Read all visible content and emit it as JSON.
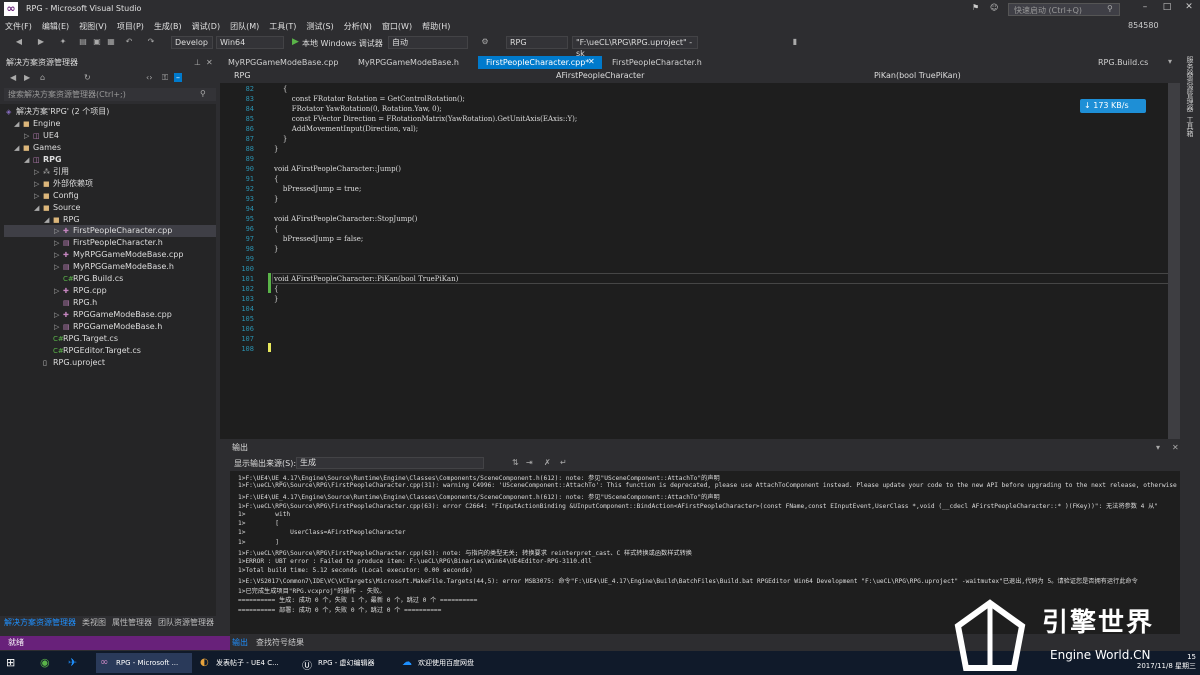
{
  "app": {
    "title": "RPG - Microsoft Visual Studio",
    "quick_launch": "快速启动 (Ctrl+Q)",
    "user_id": "854580"
  },
  "menu": [
    "文件(F)",
    "编辑(E)",
    "视图(V)",
    "项目(P)",
    "生成(B)",
    "调试(D)",
    "团队(M)",
    "工具(T)",
    "测试(S)",
    "分析(N)",
    "窗口(W)",
    "帮助(H)"
  ],
  "toolbar": {
    "config": "Develop",
    "platform": "Win64",
    "debugger": "本地 Windows 调试器",
    "debugger_mode": "自动",
    "project": "RPG",
    "uproject": "\"F:\\ueCL\\RPG\\RPG.uproject\" -sk"
  },
  "solution_explorer": {
    "title": "解决方案资源管理器",
    "search_placeholder": "搜索解决方案资源管理器(Ctrl+;)",
    "items": [
      {
        "label": "解决方案'RPG' (2 个项目)",
        "icon": "solution-icon"
      },
      {
        "label": "Engine",
        "icon": "folder-icon"
      },
      {
        "label": "UE4",
        "icon": "project-icon"
      },
      {
        "label": "Games",
        "icon": "folder-icon"
      },
      {
        "label": "RPG",
        "icon": "project-icon"
      },
      {
        "label": "引用",
        "icon": "reference-icon"
      },
      {
        "label": "外部依赖项",
        "icon": "dependency-icon"
      },
      {
        "label": "Config",
        "icon": "folder-icon"
      },
      {
        "label": "Source",
        "icon": "folder-icon"
      },
      {
        "label": "RPG",
        "icon": "folder-icon"
      },
      {
        "label": "FirstPeopleCharacter.cpp",
        "icon": "cpp-file-icon"
      },
      {
        "label": "FirstPeopleCharacter.h",
        "icon": "header-file-icon"
      },
      {
        "label": "MyRPGGameModeBase.cpp",
        "icon": "cpp-file-icon"
      },
      {
        "label": "MyRPGGameModeBase.h",
        "icon": "header-file-icon"
      },
      {
        "label": "RPG.Build.cs",
        "icon": "csharp-file-icon"
      },
      {
        "label": "RPG.cpp",
        "icon": "cpp-file-icon"
      },
      {
        "label": "RPG.h",
        "icon": "header-file-icon"
      },
      {
        "label": "RPGGameModeBase.cpp",
        "icon": "cpp-file-icon"
      },
      {
        "label": "RPGGameModeBase.h",
        "icon": "header-file-icon"
      },
      {
        "label": "RPG.Target.cs",
        "icon": "csharp-file-icon"
      },
      {
        "label": "RPGEditor.Target.cs",
        "icon": "csharp-file-icon"
      },
      {
        "label": "RPG.uproject",
        "icon": "file-icon"
      }
    ],
    "tabs": [
      "解决方案资源管理器",
      "类视图",
      "属性管理器",
      "团队资源管理器"
    ]
  },
  "editor": {
    "tabs": [
      "MyRPGGameModeBase.cpp",
      "MyRPGGameModeBase.h",
      "FirstPeopleCharacter.cpp*",
      "FirstPeopleCharacter.h",
      "RPG.Build.cs"
    ],
    "active_tab": "FirstPeopleCharacter.cpp*",
    "nav_project": "RPG",
    "nav_class": "AFirstPeopleCharacter",
    "nav_member": "PiKan(bool TruePiKan)",
    "net_speed": "↓ 173 KB/s",
    "lines": [
      {
        "n": "82",
        "text": "    {"
      },
      {
        "n": "83",
        "text": "        const FRotator Rotation = GetControlRotation();"
      },
      {
        "n": "84",
        "text": "        FRotator YawRotation(0, Rotation.Yaw, 0);"
      },
      {
        "n": "85",
        "text": "        const FVector Direction = FRotationMatrix(YawRotation).GetUnitAxis(EAxis::Y);"
      },
      {
        "n": "86",
        "text": "        AddMovementInput(Direction, val);"
      },
      {
        "n": "87",
        "text": "    }"
      },
      {
        "n": "88",
        "text": "}"
      },
      {
        "n": "89",
        "text": ""
      },
      {
        "n": "90",
        "text": "void AFirstPeopleCharacter::Jump()"
      },
      {
        "n": "91",
        "text": "{"
      },
      {
        "n": "92",
        "text": "    bPressedJump = true;"
      },
      {
        "n": "93",
        "text": "}"
      },
      {
        "n": "94",
        "text": ""
      },
      {
        "n": "95",
        "text": "void AFirstPeopleCharacter::StopJump()"
      },
      {
        "n": "96",
        "text": "{"
      },
      {
        "n": "97",
        "text": "    bPressedJump = false;"
      },
      {
        "n": "98",
        "text": "}"
      },
      {
        "n": "99",
        "text": ""
      },
      {
        "n": "100",
        "text": ""
      },
      {
        "n": "101",
        "text": "void AFirstPeopleCharacter::PiKan(bool TruePiKan)"
      },
      {
        "n": "102",
        "text": "{"
      },
      {
        "n": "103",
        "text": "}"
      },
      {
        "n": "104",
        "text": ""
      },
      {
        "n": "105",
        "text": ""
      },
      {
        "n": "106",
        "text": ""
      },
      {
        "n": "107",
        "text": ""
      },
      {
        "n": "108",
        "text": ""
      }
    ]
  },
  "output": {
    "title": "输出",
    "show_from_label": "显示输出来源(S):",
    "source": "生成",
    "lines": [
      "1>F:\\UE4\\UE_4.17\\Engine\\Source\\Runtime\\Engine\\Classes\\Components/SceneComponent.h(612): note: 参见\"USceneComponent::AttachTo\"的声明",
      "1>F:\\ueCL\\RPG\\Source\\RPG\\FirstPeopleCharacter.cpp(31): warning C4996: 'USceneComponent::AttachTo': This function is deprecated, please use AttachToComponent instead. Please update your code to the new API before upgrading to the next release, otherwise",
      "1>F:\\UE4\\UE_4.17\\Engine\\Source\\Runtime\\Engine\\Classes\\Components/SceneComponent.h(612): note: 参见\"USceneComponent::AttachTo\"的声明",
      "1>F:\\ueCL\\RPG\\Source\\RPG\\FirstPeopleCharacter.cpp(63): error C2664: \"FInputActionBinding &UInputComponent::BindAction<AFirstPeopleCharacter>(const FName,const EInputEvent,UserClass *,void (__cdecl AFirstPeopleCharacter::* )(FKey))\": 无法将参数 4 从\"",
      "1>        with",
      "1>        [",
      "1>            UserClass=AFirstPeopleCharacter",
      "1>        ]",
      "1>F:\\ueCL\\RPG\\Source\\RPG\\FirstPeopleCharacter.cpp(63): note: 与指向的类型无关; 转换要求 reinterpret_cast、C 样式转换或函数样式转换",
      "1>ERROR : UBT error : Failed to produce item: F:\\ueCL\\RPG\\Binaries\\Win64\\UE4Editor-RPG-3110.dll",
      "1>Total build time: 5.12 seconds (Local executor: 0.00 seconds)",
      "1>E:\\VS2017\\Common7\\IDE\\VC\\VCTargets\\Microsoft.MakeFile.Targets(44,5): error MSB3075: 命令\"F:\\UE4\\UE_4.17\\Engine\\Build\\BatchFiles\\Build.bat RPGEditor Win64 Development \"F:\\ueCL\\RPG\\RPG.uproject\" -waitmutex\"已退出,代码为 5。请验证您是否拥有运行此命令",
      "1>已完成生成项目\"RPG.vcxproj\"的操作 - 失败。",
      "========== 生成: 成功 0 个，失败 1 个，最新 0 个，跳过 0 个 ==========",
      "========== 部署: 成功 0 个，失败 0 个，跳过 0 个 =========="
    ],
    "tabs": [
      "输出",
      "查找符号结果"
    ]
  },
  "status": {
    "text": "就绪"
  },
  "taskbar": {
    "items": [
      "RPG - Microsoft ...",
      "发表帖子 - UE4 C...",
      "RPG - 虚幻编辑器",
      "欢迎使用百度网盘"
    ],
    "time": "15",
    "date": "2017/11/8 星期三"
  },
  "watermark": {
    "text": "引擎世界",
    "subtext": "Engine World.CN"
  },
  "colors": {
    "accent": "#007acc",
    "status": "#68217a",
    "editor_bg": "#1e1e1e"
  }
}
